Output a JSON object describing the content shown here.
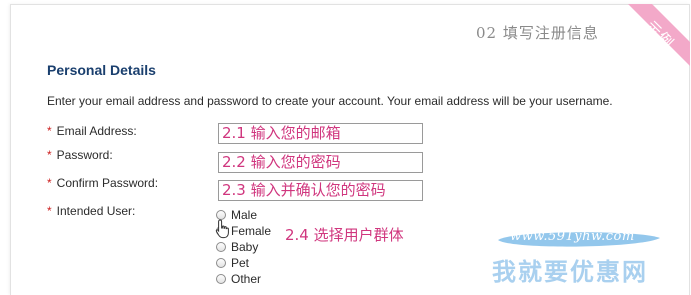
{
  "header": {
    "step_title": "02 填写注册信息",
    "corner_ribbon_label": "示例",
    "ribbon_color": "#f3a9c9"
  },
  "form": {
    "section_title": "Personal Details",
    "intro": "Enter your email address and password to create your account. Your email address will be your username.",
    "required_marker": "*",
    "fields": [
      {
        "label": "Email Address:",
        "value": "2.1 输入您的邮箱"
      },
      {
        "label": "Password:",
        "value": "2.2 输入您的密码"
      },
      {
        "label": "Confirm Password:",
        "value": "2.3 输入并确认您的密码"
      }
    ],
    "intended_user": {
      "label": "Intended User:",
      "hint": "2.4 选择用户群体",
      "options": [
        "Male",
        "Female",
        "Baby",
        "Pet",
        "Other"
      ],
      "selected": null
    }
  },
  "watermark": {
    "url": "www.591yhw.com",
    "brand": "我就要优惠网"
  },
  "colors": {
    "accent_pink": "#d0367e",
    "title_blue": "#1a3f6e",
    "required_red": "#cc1f1f"
  },
  "icons": {
    "cursor": "hand-pointer-icon"
  }
}
